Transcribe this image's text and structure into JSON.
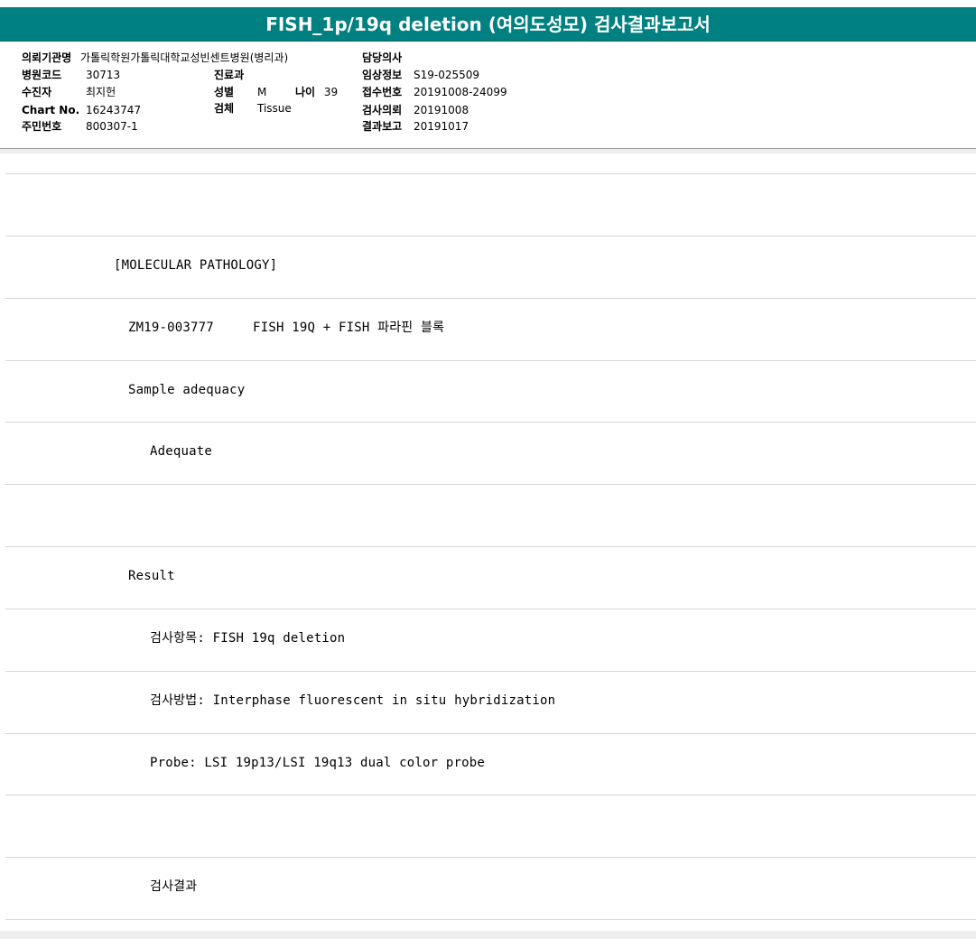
{
  "report": {
    "title": "FISH_1p/19q deletion (여의도성모) 검사결과보고서"
  },
  "header": {
    "institution_label": "의뢰기관명",
    "institution_value": "가톨릭학원가톨릭대학교성빈센트병원(병리과)",
    "hospital_code_label": "병원코드",
    "hospital_code_value": "30713",
    "patient_label": "수진자",
    "patient_value": "최지헌",
    "chart_no_label": "Chart No.",
    "chart_no_value": "16243747",
    "resident_no_label": "주민번호",
    "resident_no_value": "800307-1",
    "department_label": "진료과",
    "department_value": "",
    "sex_label": "성별",
    "sex_value": "M",
    "age_label": "나이",
    "age_value": "39",
    "specimen_label": "검체",
    "specimen_value": "Tissue",
    "doctor_label": "담당의사",
    "doctor_value": "",
    "clinical_info_label": "임상정보",
    "clinical_info_value": "S19-025509",
    "receipt_no_label": "접수번호",
    "receipt_no_value": "20191008-24099",
    "request_date_label": "검사의뢰",
    "request_date_value": "20191008",
    "report_date_label": "결과보고",
    "report_date_value": "20191017"
  },
  "body_rows": [
    "",
    "[MOLECULAR PATHOLOGY]",
    "ZM19-003777     FISH 19Q + FISH 파라핀 블록",
    "Sample adequacy",
    "Adequate",
    "",
    "Result",
    "검사항목: FISH 19q deletion",
    "검사방법: Interphase fluorescent in situ hybridization",
    "Probe: LSI 19p13/LSI 19q13 dual color probe",
    "",
    "검사결과"
  ]
}
